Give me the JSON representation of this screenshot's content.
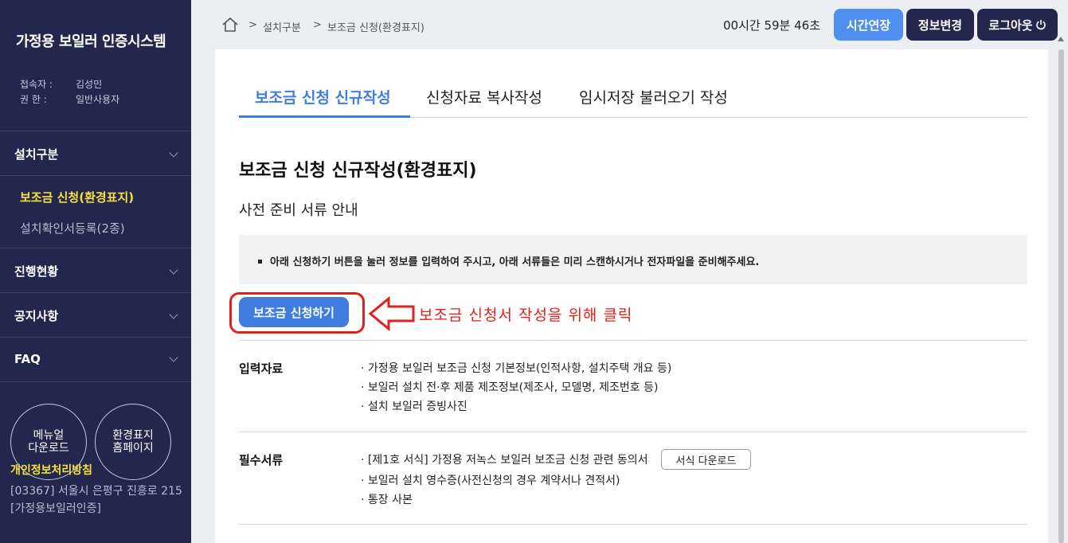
{
  "sidebar": {
    "brand": "가정용 보일러 인증시스템",
    "user_label": "접속자 :",
    "user_value": "김성민",
    "role_label": "권   한 :",
    "role_value": "일반사용자",
    "menu": [
      {
        "label": "설치구분"
      },
      {
        "label": "진행현황"
      },
      {
        "label": "공지사항"
      },
      {
        "label": "FAQ"
      }
    ],
    "submenu": [
      {
        "label": "보조금 신청(환경표지)"
      },
      {
        "label": "설치확인서등록(2종)"
      }
    ],
    "manual_line1": "메뉴얼",
    "manual_line2": "다운로드",
    "eco_line1": "환경표지",
    "eco_line2": "홈페이지",
    "privacy": "개인정보처리방침",
    "address": "[03367] 서울시 은평구 진흥로 215 [가정용보일러인증]"
  },
  "topbar": {
    "breadcrumb": [
      ">",
      "설치구분",
      ">",
      "보조금 신청(환경표지)"
    ],
    "timer": "00시간 59분 46초",
    "extend_label": "시간연장",
    "info_label": "정보변경",
    "logout_label": "로그아웃",
    "extend_color": "#4f8ff0",
    "dark_color": "#23264d"
  },
  "tabs": [
    {
      "label": "보조금 신청 신규작성",
      "active": true
    },
    {
      "label": "신청자료 복사작성",
      "active": false
    },
    {
      "label": "임시저장 불러오기 작성",
      "active": false
    }
  ],
  "main": {
    "title": "보조금 신청 신규작성(환경표지)",
    "subtitle": "사전 준비 서류 안내",
    "notice": "아래 신청하기 버튼을 눌러 정보를 입력하여 주시고, 아래 서류들은 미리 스캔하시거나 전자파일을 준비해주세요.",
    "apply_label": "보조금 신청하기",
    "annotation": "보조금 신청서 작성을 위해 클릭",
    "input_label": "입력자료",
    "input_items": [
      "· 가정용 보일러 보조금 신청 기본정보(인적사항, 설치주택 개요 등)",
      "· 보일러 설치 전·후 제품 제조정보(제조사, 모델명, 제조번호 등)",
      "· 설치 보일러 증빙사진"
    ],
    "required_label": "필수서류",
    "required_items": [
      "· [제1호 서식] 가정용 저녹스 보일러 보조금 신청 관련 동의서",
      "· 보일러 설치 영수증(사전신청의 경우 계약서나 견적서)",
      "· 통장 사본"
    ],
    "download_label": "서식 다운로드",
    "accent_color": "#3f7de0",
    "annotation_color": "#e0201c"
  }
}
